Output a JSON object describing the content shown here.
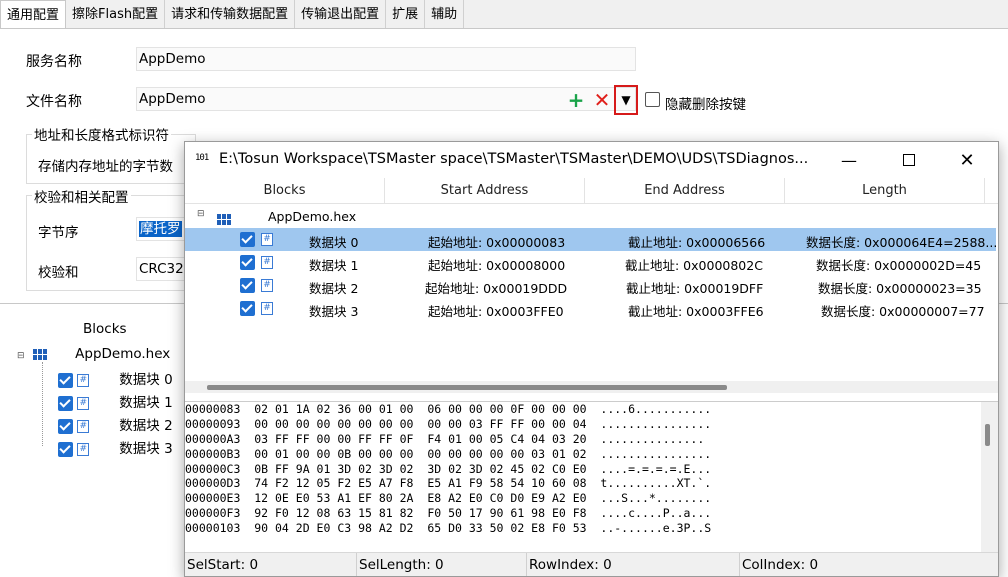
{
  "tabs": [
    "通用配置",
    "擦除Flash配置",
    "请求和传输数据配置",
    "传输退出配置",
    "扩展",
    "辅助"
  ],
  "active_tab": 0,
  "form": {
    "service_name_label": "服务名称",
    "service_name_value": "AppDemo",
    "file_name_label": "文件名称",
    "file_name_value": "AppDemo",
    "hide_delete_label": "隐藏删除按键",
    "add_icon": "plus-icon",
    "remove_icon": "x-icon",
    "dropdown_icon": "triangle-down-icon",
    "addr_group_title": "地址和长度格式标识符",
    "addr_group_label": "存储内存地址的字节数",
    "checksum_group_title": "校验和相关配置",
    "byte_order_label": "字节序",
    "byte_order_value": "摩托罗",
    "checksum_label": "校验和",
    "checksum_value": "CRC32"
  },
  "left_tree": {
    "header": "Blocks",
    "root": "AppDemo.hex",
    "items": [
      "数据块 0",
      "数据块 1",
      "数据块 2",
      "数据块 3"
    ]
  },
  "dialog": {
    "icon": "binary-file-icon",
    "title": "E:\\Tosun Workspace\\TSMaster space\\TSMaster\\TSMaster\\DEMO\\UDS\\TSDiagnos...",
    "columns": [
      "Blocks",
      "Start Address",
      "End Address",
      "Length"
    ],
    "root": "AppDemo.hex",
    "rows": [
      {
        "name": "数据块 0",
        "start": "起始地址: 0x00000083",
        "end": "截止地址: 0x00006566",
        "length": "数据长度: 0x000064E4=258​8...",
        "selected": true
      },
      {
        "name": "数据块 1",
        "start": "起始地址: 0x00008000",
        "end": "截止地址: 0x0000802C",
        "length": "数据长度: 0x0000002D=4​5",
        "selected": false
      },
      {
        "name": "数据块 2",
        "start": "起始地址: 0x00019DDD",
        "end": "截止地址: 0x00019DFF",
        "length": "数据长度: 0x00000023=35",
        "selected": false
      },
      {
        "name": "数据块 3",
        "start": "起始地址: 0x0003FFE0",
        "end": "截止地址: 0x0003FFE6",
        "length": "数据长度: 0x00000007=77",
        "selected": false
      }
    ],
    "hex_lines": [
      "00000083  02 01 1A 02 36 00 01 00  06 00 00 00 0F 00 00 00  ....6...........",
      "00000093  00 00 00 00 00 00 00 00  00 00 03 FF FF 00 00 04  ................",
      "000000A3  03 FF FF 00 00 FF FF 0F  F4 01 00 05 C4 04 03 20  ...............",
      "000000B3  00 01 00 00 0B 00 00 00  00 00 00 00 00 03 01 02  ................",
      "000000C3  0B FF 9A 01 3D 02 3D 02  3D 02 3D 02 45 02 C0 E0  ....=.=.=.=.E...",
      "000000D3  74 F2 12 05 F2 E5 A7 F8  E5 A1 F9 58 54 10 60 08  t..........XT.`.",
      "000000E3  12 0E E0 53 A1 EF 80 2A  E8 A2 E0 C0 D0 E9 A2 E0  ...S...*........",
      "000000F3  92 F0 12 08 63 15 81 82  F0 50 17 90 61 98 E0 F8  ....c....P..a...",
      "00000103  90 04 2D E0 C3 98 A2 D2  65 D0 33 50 02 E8 F0 53  ..-......e.3P..S"
    ],
    "status": {
      "sel_start": "SelStart: 0",
      "sel_length": "SelLength: 0",
      "row_index": "RowIndex: 0",
      "col_index": "ColIndex: 0"
    },
    "window_buttons": {
      "minimize": "minimize-icon",
      "maximize": "maximize-icon",
      "close": "close-icon"
    }
  }
}
